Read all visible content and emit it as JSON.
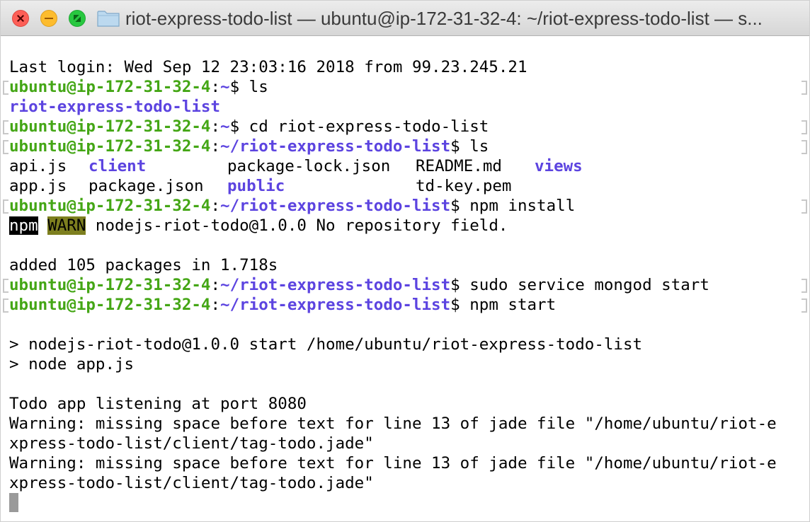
{
  "window": {
    "title": "riot-express-todo-list — ubuntu@ip-172-31-32-4: ~/riot-express-todo-list — s...",
    "colors": {
      "close": "#fd5f57",
      "minimize": "#fdbc2e",
      "maximize": "#28c840"
    }
  },
  "prompt": {
    "user_host": "ubuntu@ip-172-31-32-4",
    "colon": ":",
    "home": "~",
    "project_dir": "~/riot-express-todo-list",
    "dollar": "$"
  },
  "lines": {
    "last_login": "Last login: Wed Sep 12 23:03:16 2018 from 99.23.245.21",
    "cmd1": " ls",
    "ls1_out": "riot-express-todo-list",
    "cmd2": " cd riot-express-todo-list",
    "cmd3": " ls",
    "ls2": {
      "row1": {
        "c1": "api.js",
        "c2": "client",
        "c3": "package-lock.json",
        "c4": "README.md",
        "c5": "views"
      },
      "row2": {
        "c1": "app.js",
        "c2": "package.json",
        "c3": "public",
        "c4": "td-key.pem"
      }
    },
    "cmd4": " npm install",
    "npm_tag": "npm",
    "warn_tag": "WARN",
    "npm_warn_msg": " nodejs-riot-todo@1.0.0 No repository field.",
    "added": "added 105 packages in 1.718s",
    "cmd5": " sudo service mongod start",
    "cmd6": " npm start",
    "start1": "> nodejs-riot-todo@1.0.0 start /home/ubuntu/riot-express-todo-list",
    "start2": "> node app.js",
    "listening": "Todo app listening at port 8080",
    "warning1a": "Warning: missing space before text for line 13 of jade file \"/home/ubuntu/riot-e",
    "warning1b": "xpress-todo-list/client/tag-todo.jade\"",
    "warning2a": "Warning: missing space before text for line 13 of jade file \"/home/ubuntu/riot-e",
    "warning2b": "xpress-todo-list/client/tag-todo.jade\""
  },
  "colors": {
    "user_host": "#44a615",
    "directory": "#5c44e0",
    "npm_badge_bg": "#000000",
    "warn_badge_bg": "#7d7f1f"
  }
}
